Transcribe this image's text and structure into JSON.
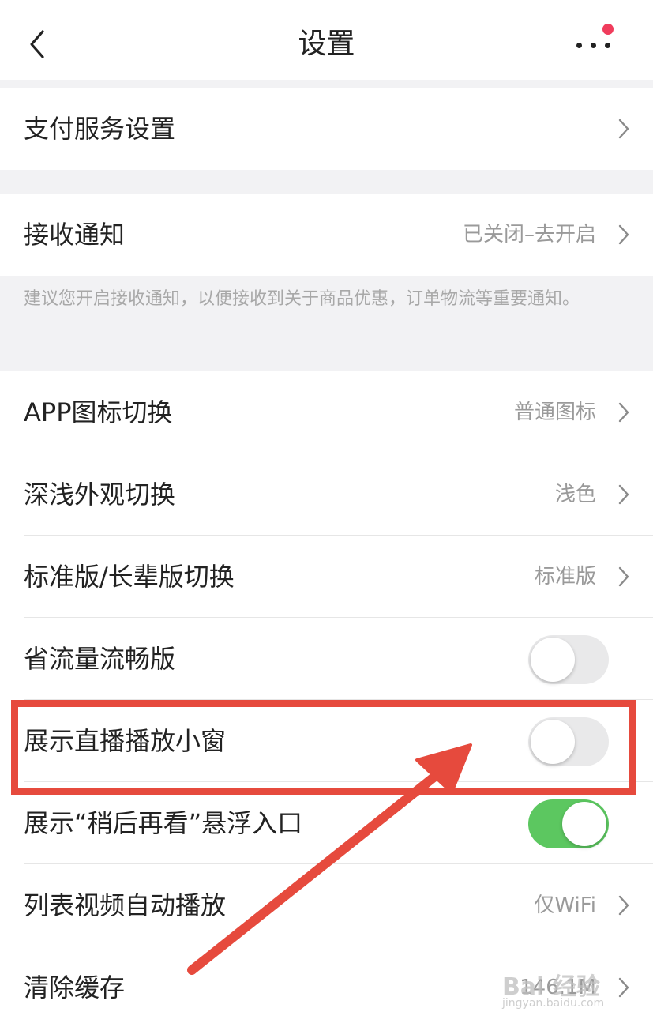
{
  "header": {
    "title": "设置",
    "has_notification_badge": true
  },
  "sections": {
    "payment": {
      "label": "支付服务设置"
    },
    "notification": {
      "label": "接收通知",
      "value": "已关闭–去开启",
      "hint": "建议您开启接收通知，以便接收到关于商品优惠，订单物流等重要通知。"
    },
    "settings": [
      {
        "label": "APP图标切换",
        "value": "普通图标"
      },
      {
        "label": "深浅外观切换",
        "value": "浅色"
      },
      {
        "label": "标准版/长辈版切换",
        "value": "标准版"
      },
      {
        "label": "省流量流畅版",
        "toggle": false
      },
      {
        "label": "展示直播播放小窗",
        "toggle": false
      },
      {
        "label": "展示“稍后再看”悬浮入口",
        "toggle": true
      },
      {
        "label": "列表视频自动播放",
        "value": "仅WiFi"
      },
      {
        "label": "清除缓存",
        "value": "146.1M"
      }
    ]
  },
  "watermark": {
    "main": "Bai 经验",
    "sub": "jingyan.baidu.com"
  },
  "colors": {
    "accent_red": "#e64a3d",
    "toggle_on": "#5cc760",
    "toggle_off": "#e9e9ea",
    "badge": "#f03c5c",
    "background_gray": "#f2f2f4"
  }
}
